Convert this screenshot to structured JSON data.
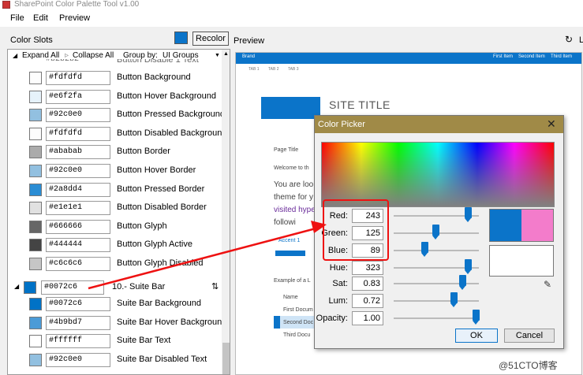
{
  "window": {
    "title": "SharePoint Color Palette Tool v1.00"
  },
  "menu": [
    "File",
    "Edit",
    "Preview"
  ],
  "left_header": {
    "label": "Color Slots",
    "recolor": "Recolor",
    "swatch_color": "#0b74c9"
  },
  "preview_header": {
    "label": "Preview",
    "right_label": "L"
  },
  "toolbar": {
    "expand_all": "Expand All",
    "collapse_all": "Collapse All",
    "group_by": "Group by:",
    "group_value": "UI Groups",
    "partial_hex": "#b2b2b2",
    "partial_label": "Button Disable 1 Text"
  },
  "slots": [
    {
      "hex": "#fdfdfd",
      "label": "Button Background",
      "color": "#fdfdfd"
    },
    {
      "hex": "#e6f2fa",
      "label": "Button Hover Background",
      "color": "#e6f2fa"
    },
    {
      "hex": "#92c0e0",
      "label": "Button Pressed Background",
      "color": "#92c0e0"
    },
    {
      "hex": "#fdfdfd",
      "label": "Button Disabled Background",
      "color": "#fdfdfd"
    },
    {
      "hex": "#ababab",
      "label": "Button Border",
      "color": "#ababab"
    },
    {
      "hex": "#92c0e0",
      "label": "Button Hover Border",
      "color": "#92c0e0"
    },
    {
      "hex": "#2a8dd4",
      "label": "Button Pressed Border",
      "color": "#2a8dd4"
    },
    {
      "hex": "#e1e1e1",
      "label": "Button Disabled Border",
      "color": "#e1e1e1"
    },
    {
      "hex": "#666666",
      "label": "Button Glyph",
      "color": "#666666"
    },
    {
      "hex": "#444444",
      "label": "Button Glyph Active",
      "color": "#444444"
    },
    {
      "hex": "#c6c6c6",
      "label": "Button Glyph Disabled",
      "color": "#c6c6c6"
    }
  ],
  "group": {
    "hex": "#0072c6",
    "label": "10.- Suite Bar",
    "color": "#0072c6"
  },
  "group_slots": [
    {
      "hex": "#0072c6",
      "label": "Suite Bar Background",
      "color": "#0072c6"
    },
    {
      "hex": "#4b9bd7",
      "label": "Suite Bar Hover Background",
      "color": "#4b9bd7"
    },
    {
      "hex": "#ffffff",
      "label": "Suite Bar Text",
      "color": "#ffffff"
    },
    {
      "hex": "#92c0e0",
      "label": "Suite Bar Disabled Text",
      "color": "#92c0e0"
    }
  ],
  "preview": {
    "brand": "Brand",
    "suite_links": [
      "First Item",
      "Second Item",
      "Third Item"
    ],
    "tabs": [
      "TAB 1",
      "TAB 2",
      "TAB 3"
    ],
    "site_title": "SITE TITLE",
    "page_title": "Page Title",
    "welcome": "Welcome to th",
    "body_lines": [
      "You are loo",
      "theme for y",
      "visited hype",
      "followi"
    ],
    "accent": "Accent 1",
    "example": "Example of a L",
    "list_header": "Name",
    "list_items": [
      "First Docum",
      "Second Doc",
      "Third Docu"
    ]
  },
  "picker": {
    "title": "Color Picker",
    "fields": [
      {
        "label": "Red:",
        "value": "243",
        "level": 0.9
      },
      {
        "label": "Green:",
        "value": "125",
        "level": 0.49
      },
      {
        "label": "Blue:",
        "value": "89",
        "level": 0.35
      },
      {
        "label": "Hue:",
        "value": "323",
        "level": 0.9
      },
      {
        "label": "Sat:",
        "value": "0.83",
        "level": 0.83
      },
      {
        "label": "Lum:",
        "value": "0.72",
        "level": 0.72
      },
      {
        "label": "Opacity:",
        "value": "1.00",
        "level": 1.0
      }
    ],
    "old_color": "#0b74c9",
    "new_color": "#f37ccb",
    "ok": "OK",
    "cancel": "Cancel"
  },
  "watermark": "@51CTO博客"
}
